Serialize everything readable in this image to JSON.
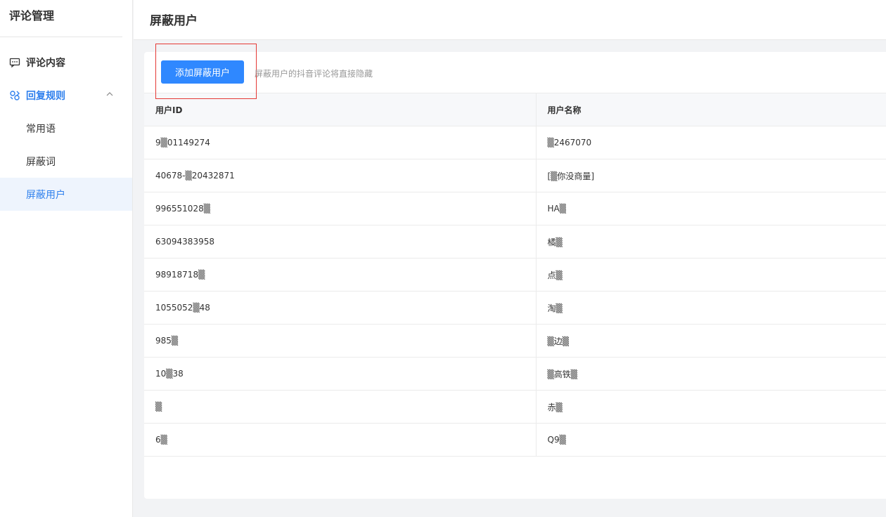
{
  "sidebar": {
    "title": "评论管理",
    "items": [
      {
        "label": "评论内容"
      },
      {
        "label": "回复规则"
      },
      {
        "label": "常用语"
      },
      {
        "label": "屏蔽词"
      },
      {
        "label": "屏蔽用户"
      }
    ]
  },
  "header": {
    "title": "屏蔽用户"
  },
  "toolbar": {
    "add_label": "添加屏蔽用户",
    "hint": "屏蔽用户的抖音评论将直接隐藏"
  },
  "table": {
    "columns": [
      "用户ID",
      "用户名称"
    ],
    "rows": [
      {
        "id": "9▒01149274",
        "name": "▒2467070"
      },
      {
        "id": "40678-▒20432871",
        "name": "[▒你没商量]"
      },
      {
        "id": "996551028▒",
        "name": "HA▒"
      },
      {
        "id": "63094383958",
        "name": "橘▒"
      },
      {
        "id": "98918718▒",
        "name": "点▒"
      },
      {
        "id": "1055052▒48",
        "name": "淘▒"
      },
      {
        "id": "985▒",
        "name": "▒边▒"
      },
      {
        "id": "10▒38",
        "name": "▒高铁▒"
      },
      {
        "id": "▒",
        "name": "赤▒"
      },
      {
        "id": "6▒",
        "name": "Q9▒"
      }
    ]
  }
}
